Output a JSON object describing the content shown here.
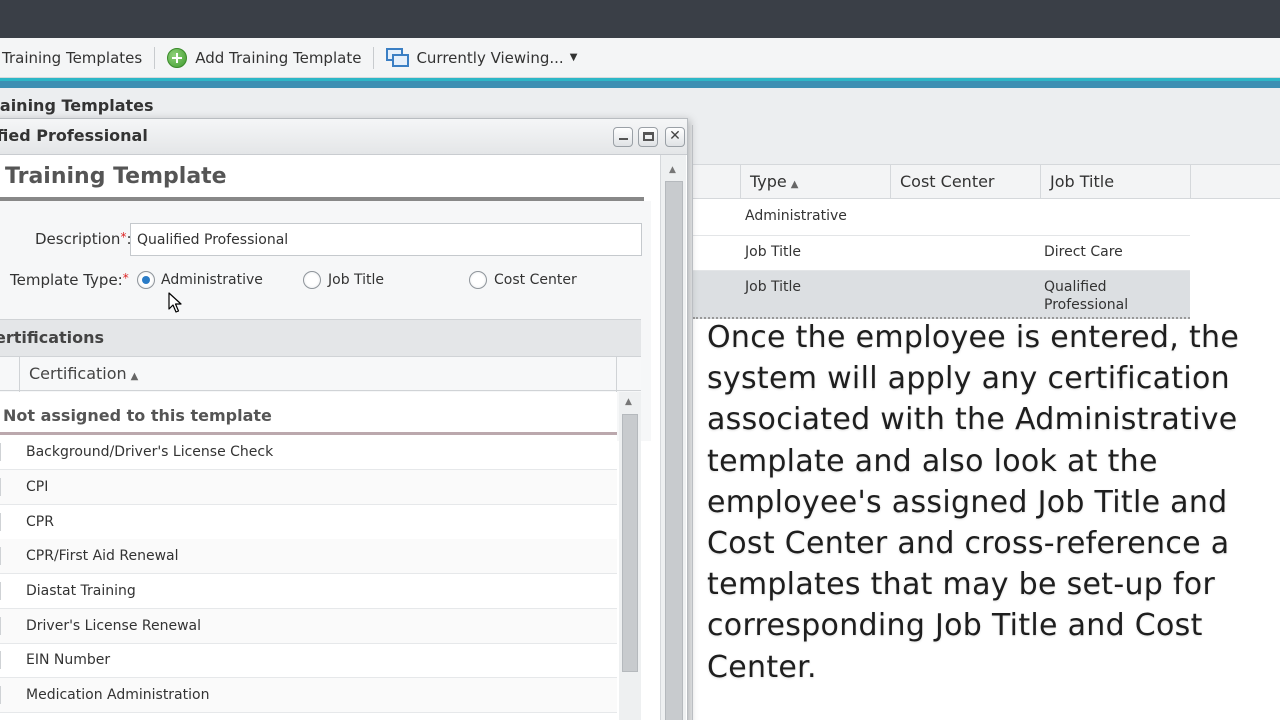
{
  "toolbar": {
    "training_templates": "Training Templates",
    "add_template": "Add Training Template",
    "currently_viewing": "Currently Viewing..."
  },
  "section": {
    "title": "raining Templates"
  },
  "dialog": {
    "title": "ified Professional",
    "heading": "Training Template",
    "description_label": "Description",
    "description_value": "Qualified Professional",
    "template_type_label": "Template Type:",
    "template_types": [
      "Administrative",
      "Job Title",
      "Cost Center"
    ],
    "selected_type": "Administrative",
    "certifications": {
      "section_title": "ertifications",
      "column_header": "Certification",
      "group_header": "Not assigned to this template",
      "items": [
        "Background/Driver's License Check",
        "CPI",
        "CPR",
        "CPR/First Aid Renewal",
        "Diastat Training",
        "Driver's License Renewal",
        "EIN Number",
        "Medication Administration"
      ]
    }
  },
  "grid": {
    "columns": [
      "Type",
      "Cost Center",
      "Job Title"
    ],
    "rows": [
      {
        "type": "Administrative",
        "cost_center": "",
        "job_title": ""
      },
      {
        "type": "Job Title",
        "cost_center": "",
        "job_title": "Direct Care"
      },
      {
        "type": "Job Title",
        "cost_center": "",
        "job_title": "Qualified Professional"
      }
    ]
  },
  "overlay": {
    "lines": [
      "Once the employee is entered, the",
      "system will apply any certification",
      "associated with the Administrative",
      "template and also look at the",
      "employee's assigned Job Title and",
      "Cost Center and cross-reference a",
      "templates that may be set-up for",
      "corresponding Job Title and Cost",
      "Center."
    ]
  },
  "colors": {
    "titlebar": "#3a3f47",
    "accent": "#2db7c7",
    "accent_dark": "#3d8fb3",
    "radio_selected": "#2a7cc7",
    "required": "#dd2222"
  }
}
